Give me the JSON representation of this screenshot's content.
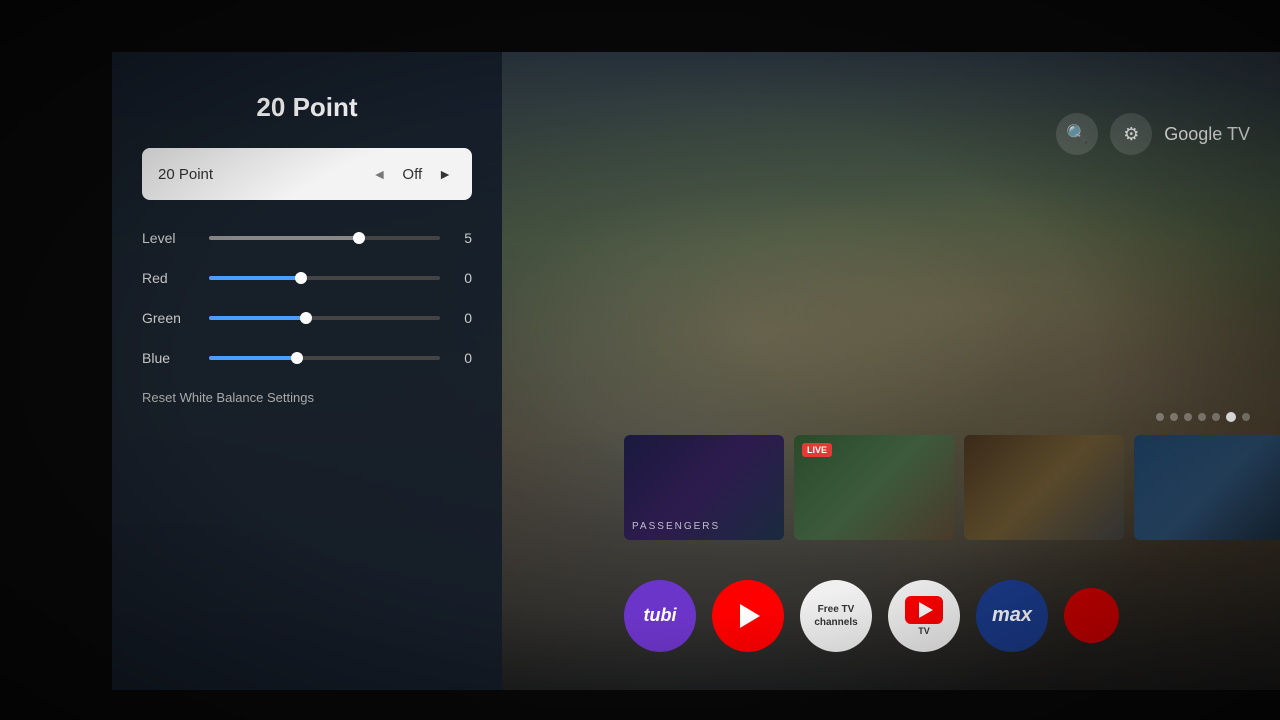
{
  "panel": {
    "title": "20 Point",
    "selected_option": "20 Point",
    "selected_value": "Off",
    "sliders": [
      {
        "label": "Level",
        "value": "5",
        "fill_class": "level",
        "thumb_class": "level"
      },
      {
        "label": "Red",
        "value": "0",
        "fill_class": "red",
        "thumb_class": "red"
      },
      {
        "label": "Green",
        "value": "0",
        "fill_class": "green",
        "thumb_class": "green"
      },
      {
        "label": "Blue",
        "value": "0",
        "fill_class": "blue",
        "thumb_class": "blue"
      }
    ],
    "reset_label": "Reset White Balance Settings"
  },
  "top_bar": {
    "brand": "Google TV"
  },
  "carousel": {
    "dots": [
      1,
      2,
      3,
      4,
      5,
      6,
      7
    ],
    "active_dot": 6
  },
  "thumbnails": [
    {
      "title": "PASSENGERS",
      "live": false
    },
    {
      "title": "",
      "live": true
    },
    {
      "title": "",
      "live": false
    },
    {
      "title": "",
      "live": false
    }
  ],
  "apps": [
    {
      "name": "tubi",
      "label": "tubi"
    },
    {
      "name": "youtube",
      "label": "▶"
    },
    {
      "name": "freetv",
      "label": "Free TV channels"
    },
    {
      "name": "youtubetv",
      "label": "▶TV"
    },
    {
      "name": "max",
      "label": "max"
    },
    {
      "name": "extra",
      "label": ""
    }
  ],
  "icons": {
    "search": "🔍",
    "settings": "⚙",
    "arrow_left": "◄",
    "arrow_right": "►"
  }
}
